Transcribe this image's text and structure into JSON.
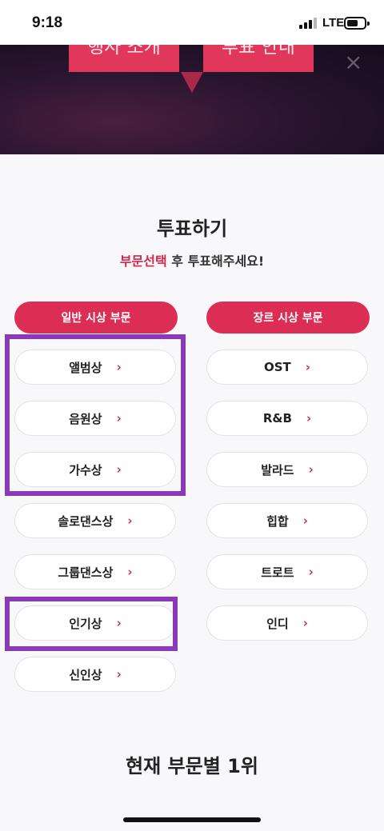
{
  "status_bar": {
    "time": "9:18",
    "network": "LTE"
  },
  "banner": {
    "tab_left": "행사 소개",
    "tab_right": "투표 안내"
  },
  "vote": {
    "title": "투표하기",
    "subtitle_accent": "부문선택",
    "subtitle_rest": " 후 투표해주세요!"
  },
  "general": {
    "header": "일반 시상 부문",
    "items": [
      "앨범상",
      "음원상",
      "가수상",
      "솔로댄스상",
      "그룹댄스상",
      "인기상",
      "신인상"
    ]
  },
  "genre": {
    "header": "장르 시상 부문",
    "items": [
      "OST",
      "R&B",
      "발라드",
      "힙합",
      "트로트",
      "인디"
    ]
  },
  "ranking": {
    "title": "현재 부문별 1위"
  },
  "chevron": "›",
  "colors": {
    "accent": "#dc2d55",
    "highlight": "#8a3ab8"
  }
}
